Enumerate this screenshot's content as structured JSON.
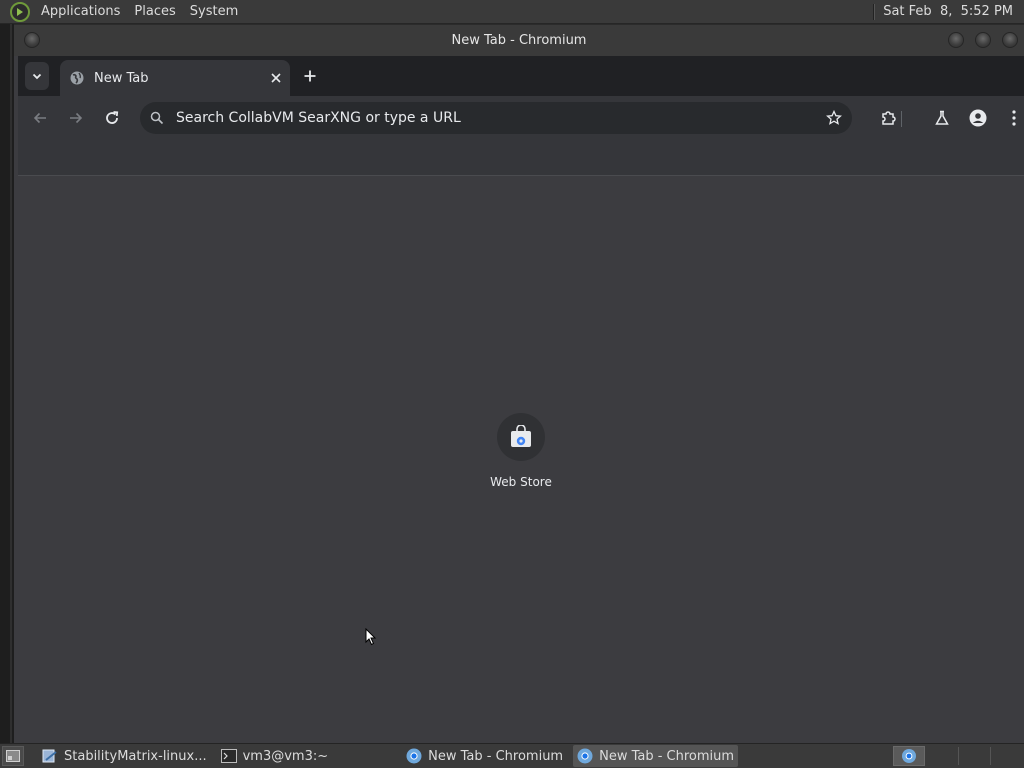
{
  "top_panel": {
    "menus": [
      "Applications",
      "Places",
      "System"
    ],
    "clock": "Sat Feb  8,  5:52 PM"
  },
  "window": {
    "title": "New Tab - Chromium"
  },
  "browser": {
    "tab": {
      "title": "New Tab"
    },
    "omnibox": {
      "placeholder": "Search CollabVM SearXNG or type a URL"
    },
    "shortcuts": [
      {
        "label": "Web Store",
        "icon": "web-store-icon"
      }
    ]
  },
  "taskbar": {
    "tasks": [
      {
        "label": "StabilityMatrix-linux...",
        "icon": "installer-icon",
        "active": false
      },
      {
        "label": "vm3@vm3:~",
        "icon": "terminal-icon",
        "active": false
      },
      {
        "label": "New Tab - Chromium",
        "icon": "chromium-icon",
        "active": false
      },
      {
        "label": "New Tab - Chromium",
        "icon": "chromium-icon",
        "active": true
      }
    ]
  },
  "colors": {
    "panel": "#3a3a3a",
    "tabstrip": "#202124",
    "toolbar": "#35363a",
    "omnibox": "#282a2d",
    "content": "#3c3c40",
    "text": "#e8eaed"
  }
}
